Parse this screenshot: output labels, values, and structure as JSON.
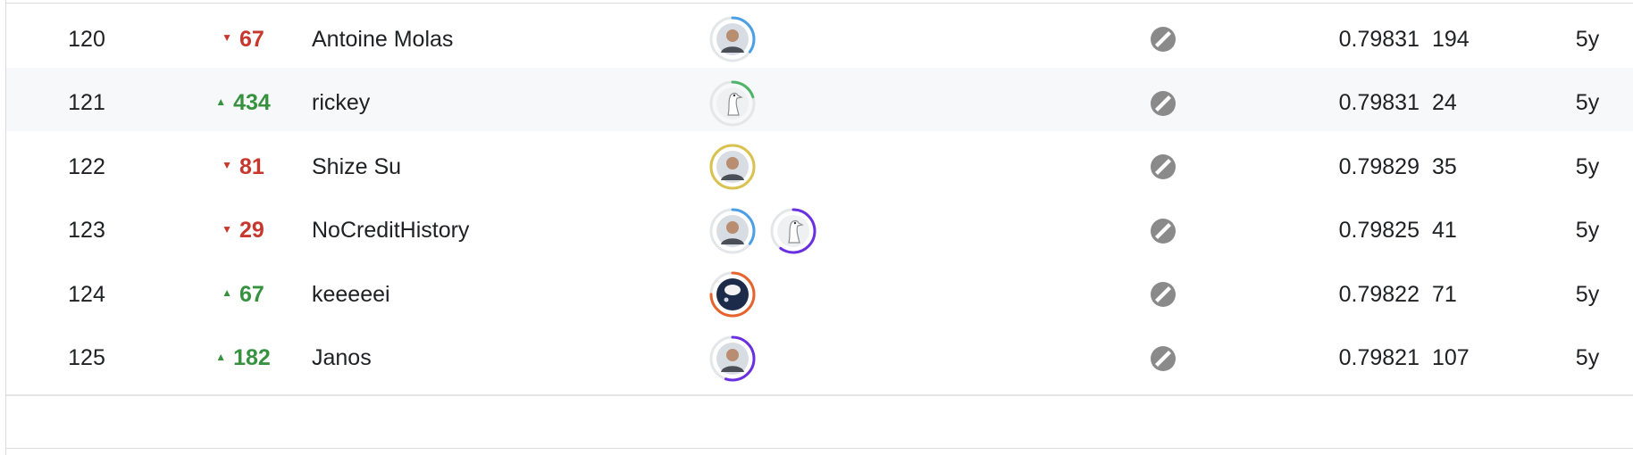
{
  "colors": {
    "up": "#37923f",
    "down": "#c8372d",
    "ring_blue": "#4a9fe6",
    "ring_green": "#4db56a",
    "ring_gold": "#d9c24e",
    "ring_purple": "#6a2fe0",
    "ring_orange": "#e8632c",
    "medal": "#8a8a8a"
  },
  "leaderboard": {
    "rows": [
      {
        "rank": "120",
        "direction": "down",
        "change": "67",
        "team": "Antoine Molas",
        "score": "0.79831",
        "entries": "194",
        "last": "5y",
        "avatars": [
          {
            "icon": "person-avatar-icon",
            "ring": "#4a9fe6",
            "progress": 0.35
          }
        ]
      },
      {
        "rank": "121",
        "direction": "up",
        "change": "434",
        "team": "rickey",
        "score": "0.79831",
        "entries": "24",
        "last": "5y",
        "avatars": [
          {
            "icon": "default-goose-avatar-icon",
            "ring": "#4db56a",
            "progress": 0.2
          }
        ]
      },
      {
        "rank": "122",
        "direction": "down",
        "change": "81",
        "team": "Shize Su",
        "score": "0.79829",
        "entries": "35",
        "last": "5y",
        "avatars": [
          {
            "icon": "person-avatar-icon",
            "ring": "#d9c24e",
            "progress": 1.0
          }
        ]
      },
      {
        "rank": "123",
        "direction": "down",
        "change": "29",
        "team": "NoCreditHistory",
        "score": "0.79825",
        "entries": "41",
        "last": "5y",
        "avatars": [
          {
            "icon": "person-avatar-icon",
            "ring": "#4a9fe6",
            "progress": 0.35
          },
          {
            "icon": "default-goose-avatar-icon",
            "ring": "#6a2fe0",
            "progress": 0.6
          }
        ]
      },
      {
        "rank": "124",
        "direction": "up",
        "change": "67",
        "team": "keeeeei",
        "score": "0.79822",
        "entries": "71",
        "last": "5y",
        "avatars": [
          {
            "icon": "cartoon-avatar-icon",
            "ring": "#e8632c",
            "progress": 0.75
          }
        ]
      },
      {
        "rank": "125",
        "direction": "up",
        "change": "182",
        "team": "Janos",
        "score": "0.79821",
        "entries": "107",
        "last": "5y",
        "avatars": [
          {
            "icon": "person-avatar-icon",
            "ring": "#6a2fe0",
            "progress": 0.55
          }
        ]
      }
    ]
  }
}
